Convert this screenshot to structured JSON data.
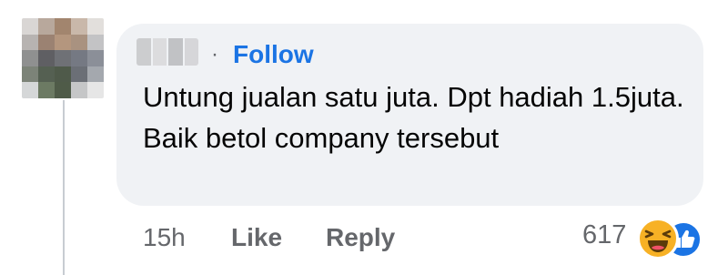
{
  "comment": {
    "follow_label": "Follow",
    "separator": "·",
    "text": "Untung jualan satu juta. Dpt hadiah 1.5juta. Baik betol company tersebut",
    "timestamp": "15h",
    "like_label": "Like",
    "reply_label": "Reply",
    "reaction_count": "617",
    "reactions": [
      "haha-icon",
      "like-icon"
    ]
  },
  "colors": {
    "bubble": "#f0f2f5",
    "follow": "#1b74e4",
    "meta_text": "#65676b",
    "text": "#050505"
  }
}
